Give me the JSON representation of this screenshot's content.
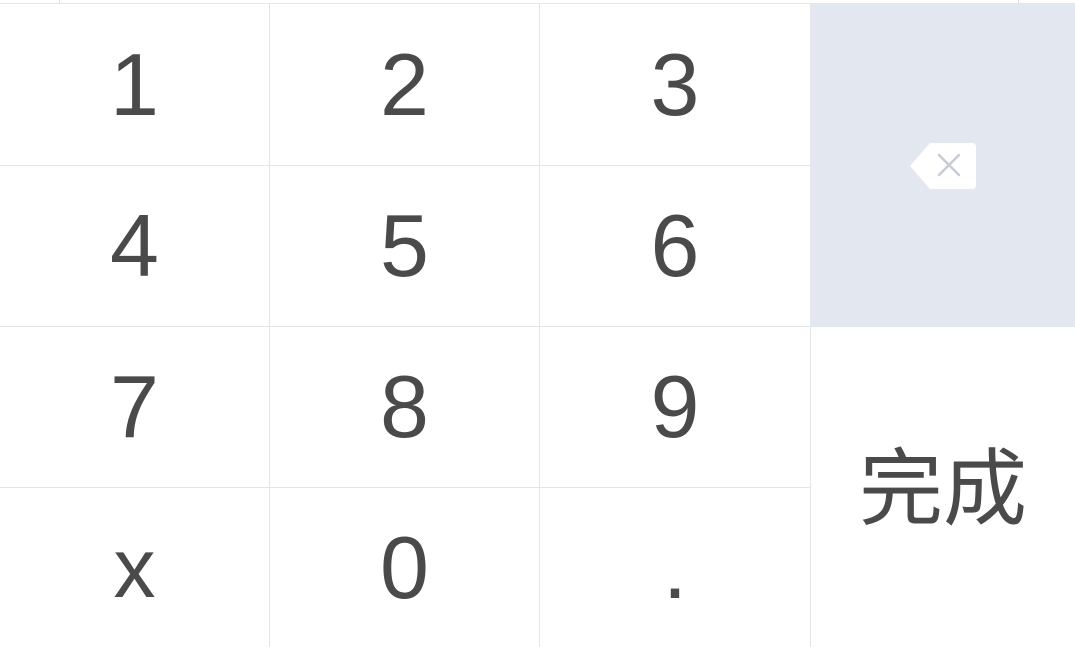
{
  "keypad": {
    "keys": {
      "one": "1",
      "two": "2",
      "three": "3",
      "four": "4",
      "five": "5",
      "six": "6",
      "seven": "7",
      "eight": "8",
      "nine": "9",
      "x": "x",
      "zero": "0",
      "dot": "."
    },
    "done_label": "完成",
    "backspace_icon": "backspace-icon"
  },
  "colors": {
    "key_text": "#4a4a4a",
    "backspace_bg": "#e3e7ef",
    "divider": "#e4e4e4",
    "background": "#ffffff"
  }
}
